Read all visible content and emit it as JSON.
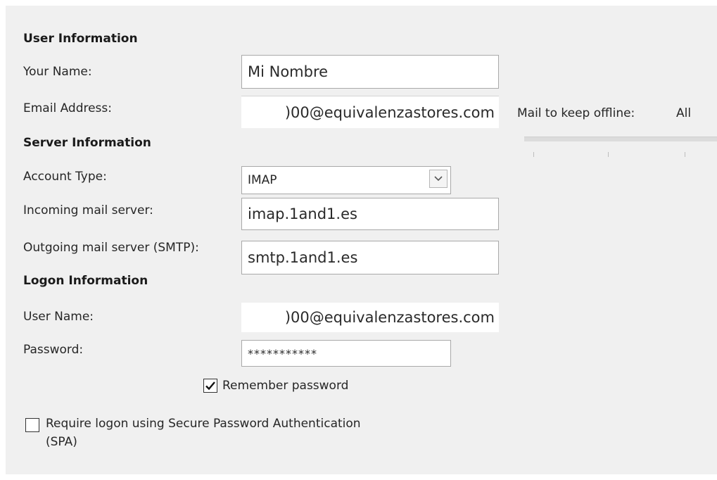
{
  "user_information": {
    "heading": "User Information",
    "your_name_label": "Your Name:",
    "your_name_value": "Mi Nombre",
    "email_label": "Email Address:",
    "email_value": ")00@equivalenzastores.com"
  },
  "server_information": {
    "heading": "Server Information",
    "account_type_label": "Account Type:",
    "account_type_value": "IMAP",
    "incoming_label": "Incoming mail server:",
    "incoming_value": "imap.1and1.es",
    "outgoing_label": "Outgoing mail server (SMTP):",
    "outgoing_value": "smtp.1and1.es"
  },
  "logon_information": {
    "heading": "Logon Information",
    "user_name_label": "User Name:",
    "user_name_value": ")00@equivalenzastores.com",
    "password_label": "Password:",
    "password_value": "***********",
    "remember_password_label": "Remember password",
    "remember_password_checked": true,
    "spa_label_line1": "Require logon using Secure Password Authentication",
    "spa_label_line2": "(SPA)",
    "spa_checked": false
  },
  "offline": {
    "label": "Mail to keep offline:",
    "value": "All"
  },
  "icons": {
    "dropdown": "chevron-down-icon",
    "check": "checkmark-icon"
  },
  "colors": {
    "panel_bg": "#f0f0f0",
    "field_border": "#a9a9a9"
  }
}
